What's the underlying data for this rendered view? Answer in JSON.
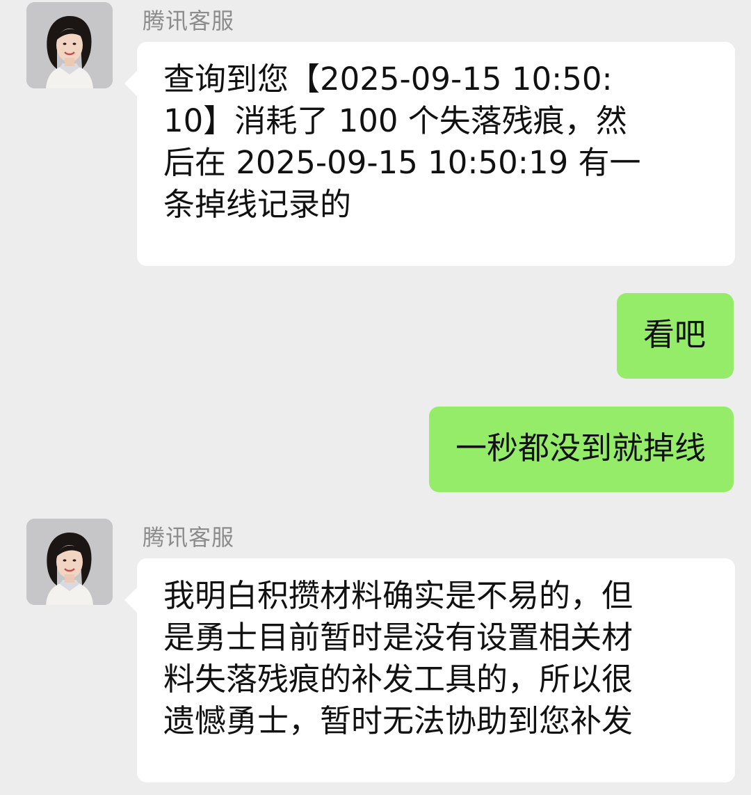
{
  "chat": {
    "messages": [
      {
        "side": "left",
        "sender": "腾讯客服",
        "avatar_icon": "agent-avatar-photo",
        "text": "查询到您【2025-09-15 10:50:\n10】消耗了 100 个失落残痕，然\n后在 2025-09-15 10:50:19 有一\n条掉线记录的"
      },
      {
        "side": "right",
        "text": "看吧"
      },
      {
        "side": "right",
        "text": "一秒都没到就掉线"
      },
      {
        "side": "left",
        "sender": "腾讯客服",
        "avatar_icon": "agent-avatar-photo",
        "text": "我明白积攒材料确实是不易的，但\n是勇士目前暂时是没有设置相关材\n料失落残痕的补发工具的，所以很\n遗憾勇士，暂时无法协助到您补发"
      }
    ]
  },
  "colors": {
    "background": "#ededed",
    "incoming_bubble": "#ffffff",
    "outgoing_bubble": "#95ec69",
    "sender_name": "#8c8c8c"
  }
}
